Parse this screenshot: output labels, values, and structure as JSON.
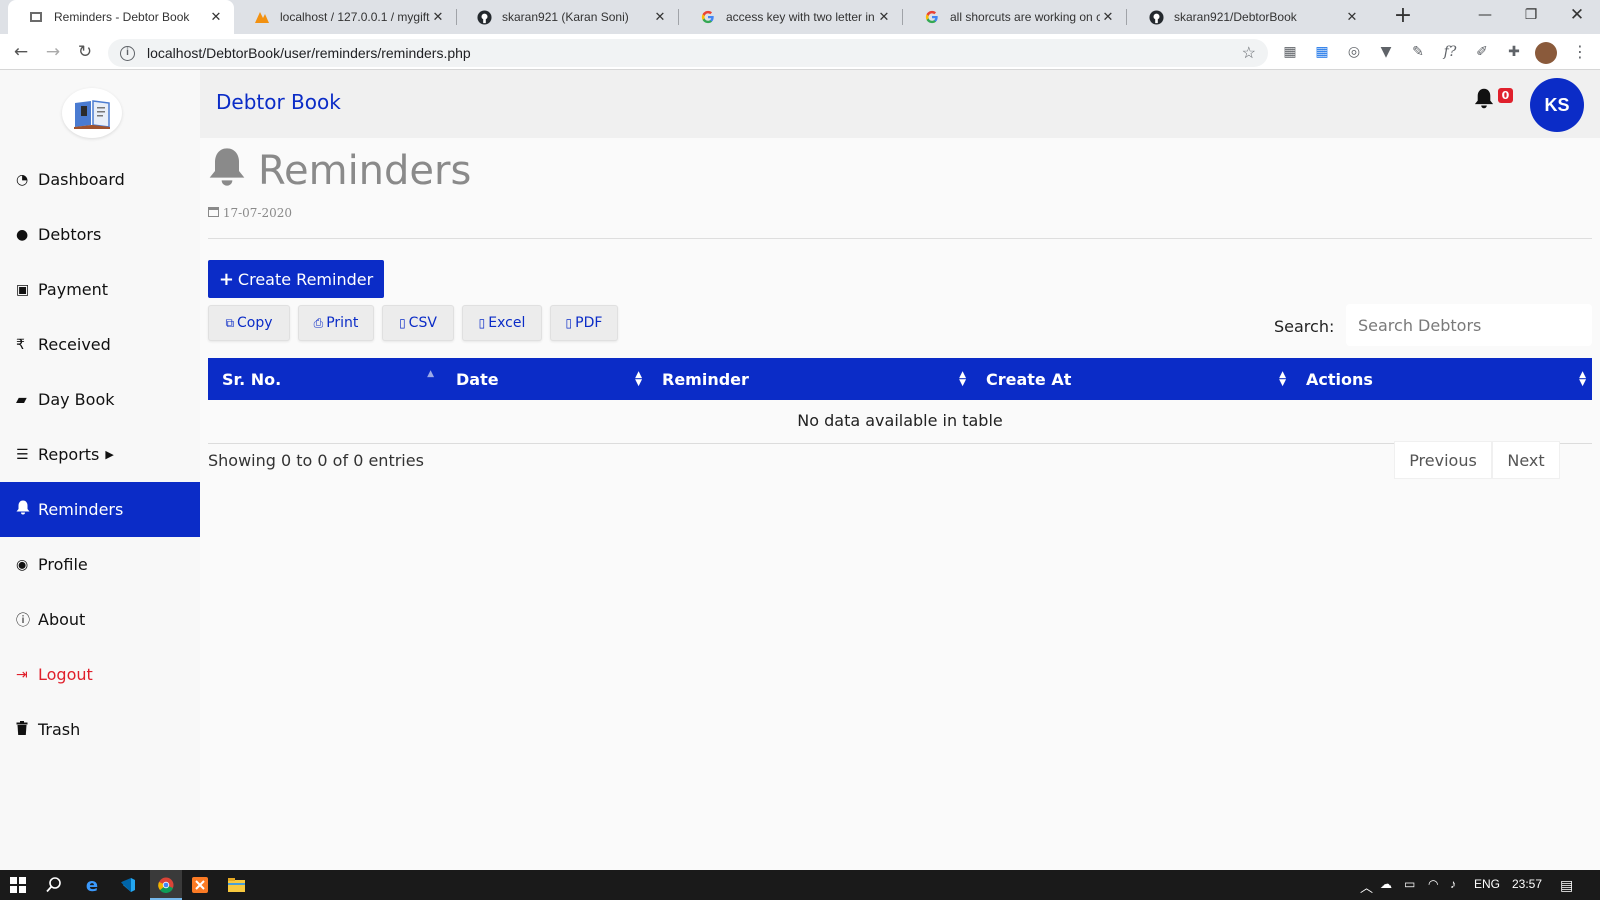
{
  "browser": {
    "tabs": [
      {
        "title": "Reminders - Debtor Book",
        "active": true
      },
      {
        "title": "localhost / 127.0.0.1 / mygift / ",
        "active": false
      },
      {
        "title": "skaran921 (Karan Soni)",
        "active": false
      },
      {
        "title": "access key with two letter in ht",
        "active": false
      },
      {
        "title": "all shorcuts are working on chr",
        "active": false
      },
      {
        "title": "skaran921/DebtorBook",
        "active": false
      }
    ],
    "url": "localhost/DebtorBook/user/reminders/reminders.php"
  },
  "app": {
    "brand": "Debtor Book",
    "notification_count": "0",
    "user_initials": "KS",
    "accent_color": "#0b2cc7"
  },
  "sidebar": {
    "items": [
      {
        "label": "Dashboard",
        "icon": "dashboard-icon"
      },
      {
        "label": "Debtors",
        "icon": "users-icon"
      },
      {
        "label": "Payment",
        "icon": "money-icon"
      },
      {
        "label": "Received",
        "icon": "rupee-icon"
      },
      {
        "label": "Day Book",
        "icon": "book-icon"
      },
      {
        "label": "Reports",
        "icon": "list-icon"
      },
      {
        "label": "Reminders",
        "icon": "bell-icon"
      },
      {
        "label": "Profile",
        "icon": "user-circle-icon"
      },
      {
        "label": "About",
        "icon": "info-icon"
      },
      {
        "label": "Logout",
        "icon": "sign-out-icon"
      },
      {
        "label": "Trash",
        "icon": "trash-icon"
      }
    ]
  },
  "page": {
    "title": "Reminders",
    "date": "17-07-2020",
    "create_button": "Create Reminder",
    "export_buttons": [
      "Copy",
      "Print",
      "CSV",
      "Excel",
      "PDF"
    ],
    "search_label": "Search:",
    "search_placeholder": "Search Debtors"
  },
  "table": {
    "columns": [
      "Sr. No.",
      "Date",
      "Reminder",
      "Create At",
      "Actions"
    ],
    "empty_message": "No data available in table",
    "info": "Showing 0 to 0 of 0 entries",
    "previous": "Previous",
    "next": "Next"
  },
  "taskbar": {
    "language": "ENG",
    "time": "23:57"
  }
}
